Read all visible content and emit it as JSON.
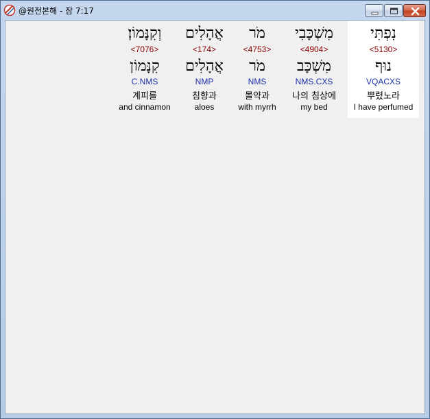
{
  "window": {
    "title": "@원전본해 - 잠 7:17"
  },
  "words": [
    {
      "hebrew": "נִפְתִּי",
      "strong": "<5130>",
      "lemma": "נוּף",
      "morph": "VQACXS",
      "korean": "뿌렸노라",
      "english": "I have perfumed",
      "selected": true
    },
    {
      "hebrew": "מִשְׁכָּבִי",
      "strong": "<4904>",
      "lemma": "מִשְׁכָּב",
      "morph": "NMS.CXS",
      "korean": "나의 침상에",
      "english": "my bed",
      "selected": false
    },
    {
      "hebrew": "מֹר",
      "strong": "<4753>",
      "lemma": "מֹר",
      "morph": "NMS",
      "korean": "몰약과",
      "english": "with myrrh",
      "selected": false
    },
    {
      "hebrew": "אֲהָלִים",
      "strong": "<174>",
      "lemma": "אֲהָלִים",
      "morph": "NMP",
      "korean": "침향과",
      "english": "aloes",
      "selected": false
    },
    {
      "hebrew": "וְקִנָּמוֹן׃",
      "strong": "<7076>",
      "lemma": "קִנָּמוֹן",
      "morph": "C.NMS",
      "korean": "계피를",
      "english": "and cinnamon",
      "selected": false
    }
  ],
  "colors": {
    "strong": "#8b0000",
    "morph": "#1a2fa8",
    "selected_bg": "#ffffff",
    "client_bg": "#f0f0f0"
  }
}
